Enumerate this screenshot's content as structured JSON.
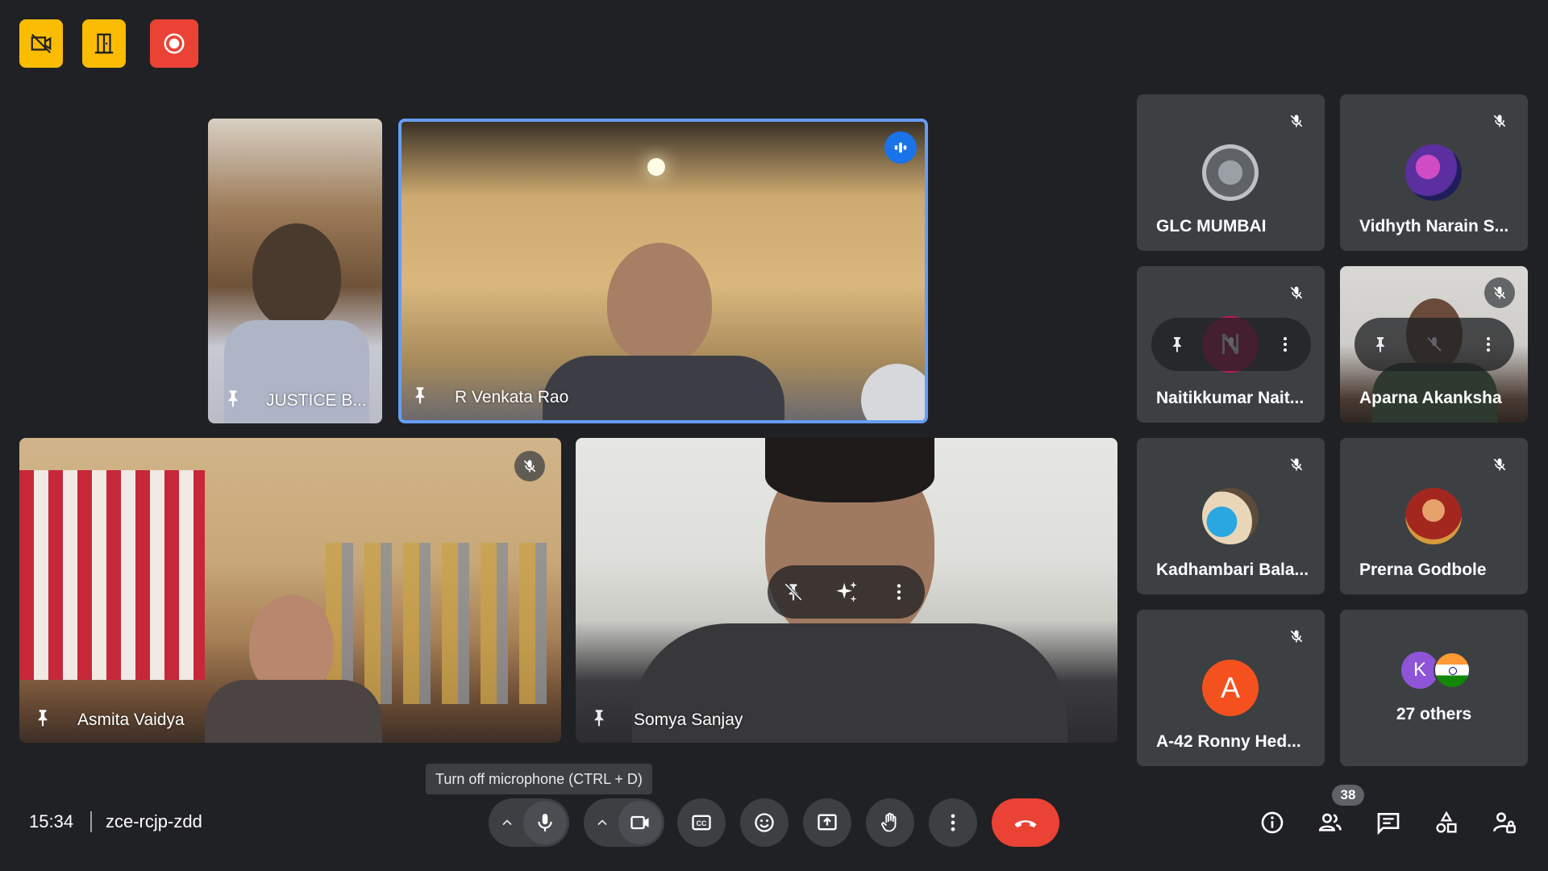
{
  "meeting": {
    "time": "15:34",
    "code": "zce-rcjp-zdd"
  },
  "tooltip": "Turn off microphone (CTRL + D)",
  "colors": {
    "background": "#202124",
    "tile": "#3c4043",
    "badge_yellow": "#fbbc04",
    "badge_red": "#ea4335",
    "speaking_blue": "#1a73e8",
    "end_call": "#ea4335",
    "avatar_orange": "#f4511e",
    "avatar_purple": "#8e55d9"
  },
  "top_badges": [
    {
      "icon": "no-video-feed-icon"
    },
    {
      "icon": "door-exit-icon"
    },
    {
      "icon": "recording-icon"
    }
  ],
  "video_tiles": [
    {
      "name": "JUSTICE B..."
    },
    {
      "name": "R Venkata Rao"
    },
    {
      "name": "Asmita Vaidya"
    },
    {
      "name": "Somya Sanjay"
    }
  ],
  "grid_tiles": [
    {
      "name": "GLC MUMBAI"
    },
    {
      "name": "Vidhyth Narain S..."
    },
    {
      "name": "Naitikkumar Nait...",
      "initial": "N"
    },
    {
      "name": "Aparna Akanksha"
    },
    {
      "name": "Kadhambari Bala..."
    },
    {
      "name": "Prerna Godbole"
    },
    {
      "name": "A-42 Ronny Hed...",
      "initial": "A"
    },
    {
      "name": "27 others",
      "initial": "K"
    }
  ],
  "people_count": "38",
  "controls": [
    "microphone-options-chevron-icon",
    "microphone-icon",
    "camera-options-chevron-icon",
    "camera-icon",
    "captions-icon",
    "emoji-reactions-icon",
    "present-screen-icon",
    "raise-hand-icon",
    "more-options-icon",
    "end-call-icon"
  ],
  "right_controls": [
    "meeting-details-icon",
    "people-icon",
    "chat-icon",
    "activities-icon",
    "host-controls-icon"
  ]
}
